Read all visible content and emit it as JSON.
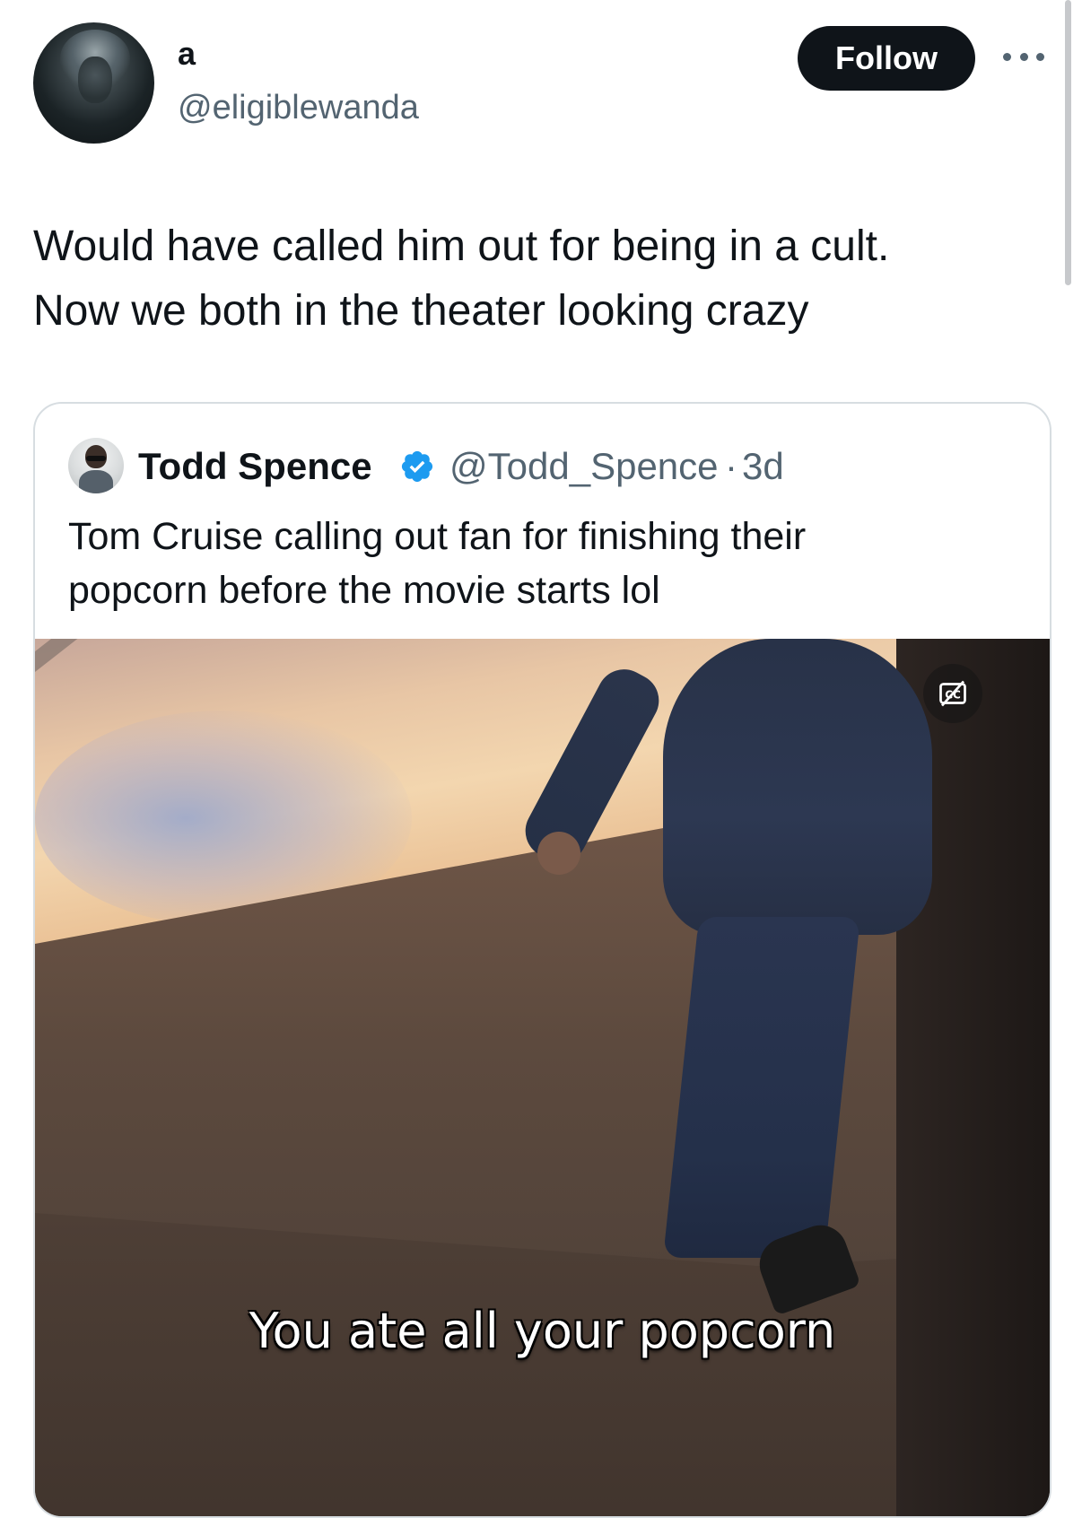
{
  "author": {
    "display_name": "a",
    "handle": "@eligiblewanda"
  },
  "actions": {
    "follow_label": "Follow",
    "more_icon": "more-horizontal-icon"
  },
  "tweet": {
    "lines": [
      "Would have called him out for being in a cult.",
      "Now we both in the theater looking crazy"
    ]
  },
  "quote": {
    "display_name": "Todd Spence",
    "verified_icon": "verified-badge-icon",
    "handle": "@Todd_Spence",
    "separator": "·",
    "time": "3d",
    "lines": [
      "Tom Cruise calling out fan for finishing their",
      "popcorn before the movie starts lol"
    ],
    "media": {
      "caption": "You ate all your popcorn",
      "cc_icon": "closed-captions-off-icon"
    }
  },
  "colors": {
    "text": "#0f1419",
    "secondary": "#536471",
    "verified": "#1d9bf0",
    "border": "#d7dde1"
  }
}
